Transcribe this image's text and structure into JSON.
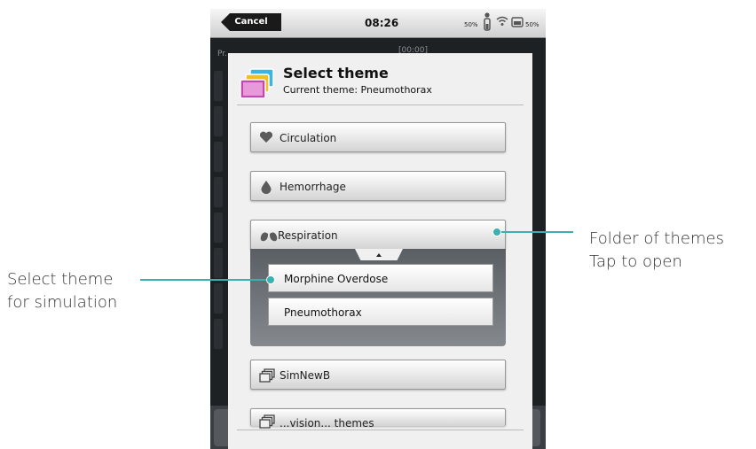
{
  "statusbar": {
    "cancel_label": "Cancel",
    "time": "08:26",
    "battery_left": "50%",
    "battery_right": "50%"
  },
  "background": {
    "label": "Pr...",
    "time": "[00:00]"
  },
  "dialog": {
    "title": "Select theme",
    "subtitle": "Current theme: Pneumothorax",
    "items": [
      {
        "label": "Circulation",
        "icon": "heart-icon"
      },
      {
        "label": "Hemorrhage",
        "icon": "drop-icon"
      },
      {
        "label": "Respiration",
        "icon": "lungs-icon",
        "type": "folder",
        "expanded": true,
        "children": [
          {
            "label": "Morphine Overdose"
          },
          {
            "label": "Pneumothorax"
          }
        ]
      },
      {
        "label": "SimNewB",
        "icon": "folder-stack-icon",
        "type": "folder"
      },
      {
        "label": "...vision... themes",
        "icon": "folder-stack-icon",
        "type": "folder"
      }
    ]
  },
  "annotations": {
    "folder_line1": "Folder of themes",
    "folder_line2": "Tap to open",
    "select_line1": "Select theme",
    "select_line2": "for simulation"
  },
  "colors": {
    "callout": "#3bb0b0",
    "dialog_bg": "#f0f0f0",
    "device_bg": "#1e2124"
  }
}
